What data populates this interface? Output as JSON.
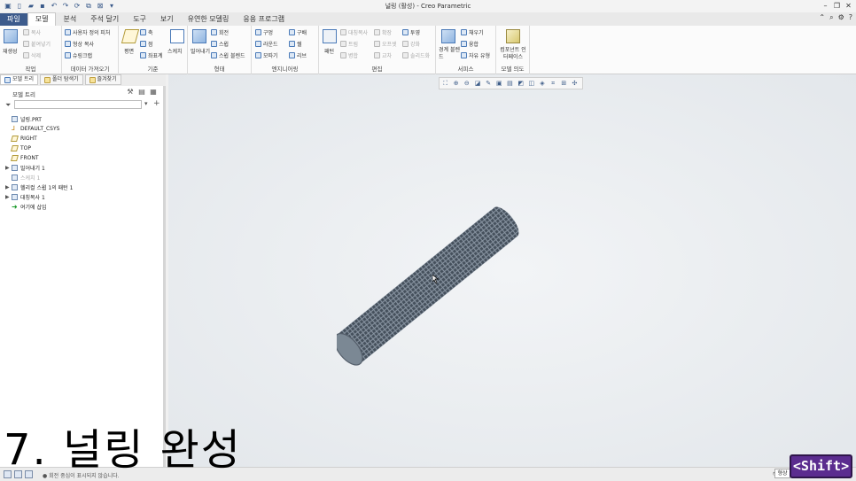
{
  "window": {
    "title": "널링 (활성) - Creo Parametric"
  },
  "ribbon_tabs": [
    "파일",
    "모델",
    "분석",
    "주석 달기",
    "도구",
    "보기",
    "유연한 모델링",
    "응용 프로그램"
  ],
  "groups": {
    "operations": {
      "label": "작업",
      "big": "재생성",
      "items": [
        "복사",
        "붙여넣기",
        "삭제"
      ]
    },
    "get_data": {
      "label": "데이터 가져오기",
      "items": [
        "사용자 정의 피처",
        "형상 복사",
        "슈링크랩"
      ]
    },
    "datum": {
      "label": "기준",
      "big": "평면",
      "items": [
        "축",
        "점",
        "좌표계"
      ],
      "sketch": "스케치"
    },
    "shapes": {
      "label": "형태",
      "big": "밀어내기",
      "items": [
        "회전",
        "스윕",
        "스윕 블렌드"
      ]
    },
    "engineering": {
      "label": "엔지니어링",
      "items": [
        "구멍",
        "라운드",
        "모따기",
        "구배",
        "쉘",
        "리브"
      ]
    },
    "editing": {
      "label": "편집",
      "big": "패턴",
      "items": [
        "대칭복사",
        "트림",
        "병합",
        "확장",
        "오프셋",
        "교차",
        "투영",
        "강화",
        "솔리드화"
      ]
    },
    "surfaces": {
      "label": "서피스",
      "big": "경계 블렌드",
      "items": [
        "채우기",
        "융합",
        "자유 유형"
      ]
    },
    "model_intent": {
      "label": "모델 의도",
      "big": "컴포넌트 인터페이스"
    }
  },
  "nav_tabs": [
    "모델 트리",
    "폴더 탐색기",
    "즐겨찾기"
  ],
  "model_tree": {
    "title": "모델 트리",
    "items": [
      {
        "label": "널링.PRT",
        "icon": "part-icon",
        "expand": ""
      },
      {
        "label": "DEFAULT_CSYS",
        "icon": "csys-icon",
        "expand": ""
      },
      {
        "label": "RIGHT",
        "icon": "plane-icon",
        "expand": ""
      },
      {
        "label": "TOP",
        "icon": "plane-icon",
        "expand": ""
      },
      {
        "label": "FRONT",
        "icon": "plane-icon",
        "expand": ""
      },
      {
        "label": "밀어내기 1",
        "icon": "extrude-icon",
        "expand": "▶"
      },
      {
        "label": "스케치 1",
        "icon": "sketch-icon",
        "expand": "",
        "dim": true
      },
      {
        "label": "헬리컬 스윕 1의 패턴 1",
        "icon": "pattern-icon",
        "expand": "▶"
      },
      {
        "label": "대칭복사 1",
        "icon": "mirror-icon",
        "expand": "▶"
      },
      {
        "label": "여기에 삽입",
        "icon": "insert-arrow-icon",
        "expand": ""
      }
    ]
  },
  "status": {
    "message": "● 회전 중심이 표시되지 않습니다.",
    "right": "형상"
  },
  "caption": "7. 널링 완성",
  "shift_badge": "<Shift>"
}
